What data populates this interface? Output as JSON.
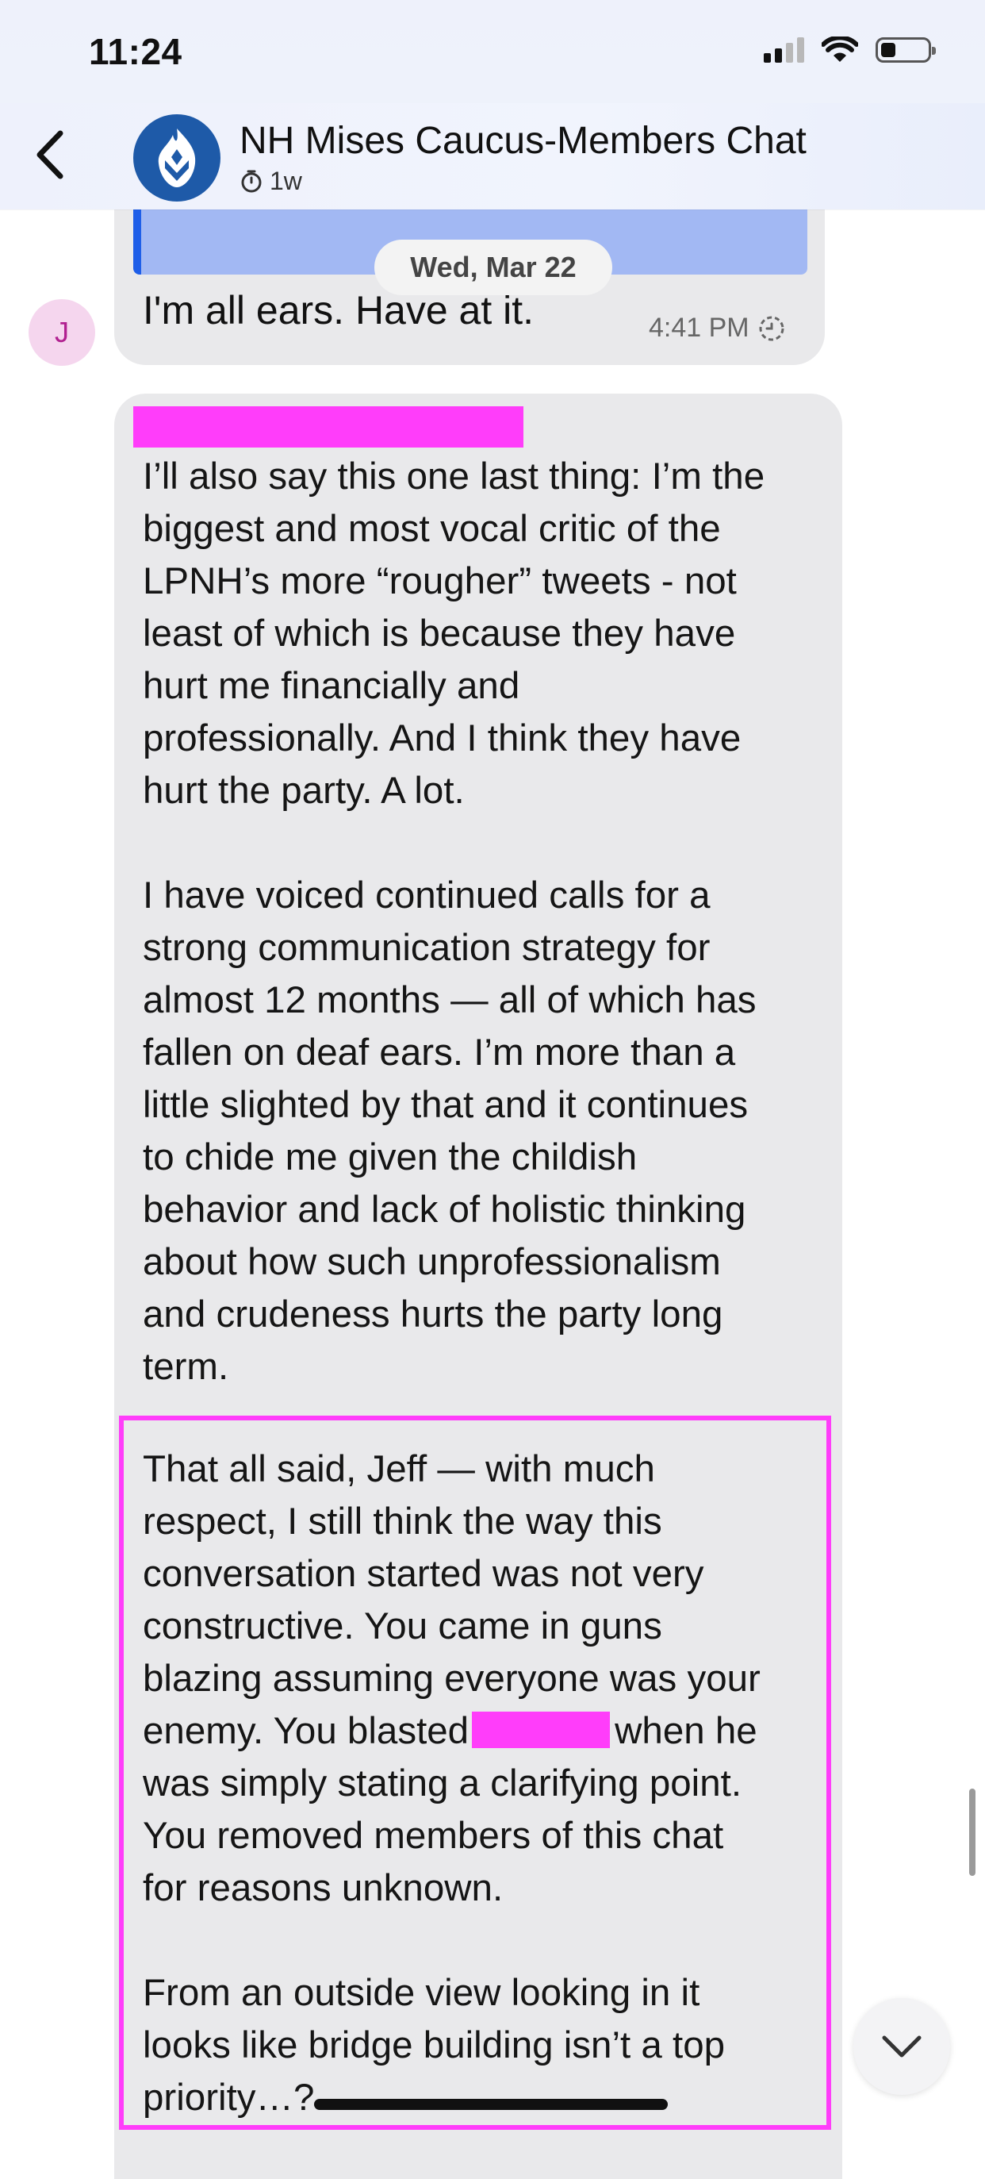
{
  "status_bar": {
    "time": "11:24"
  },
  "header": {
    "title": "NH Mises Caucus-Members Chat",
    "subtitle": "1w"
  },
  "previous_message": {
    "date_separator": "Wed, Mar 22",
    "avatar_initial": "J",
    "text": "I'm all ears. Have at it.",
    "time": "4:41 PM"
  },
  "message": {
    "paragraphs": [
      "I’ll also say this one last thing: I’m the\nbiggest and most vocal critic of the\nLPNH’s more “rougher” tweets - not\nleast of which is because they have\nhurt me financially and\nprofessionally. And I think they have\nhurt the party. A lot.",
      "I have voiced continued calls for a\nstrong communication strategy for\nalmost 12 months — all of which has\nfallen on deaf ears. I’m more than a\nlittle slighted by that and it continues\nto chide me given the  childish\nbehavior and lack of holistic thinking\nabout how such unprofessionalism\nand crudeness hurts the party long\nterm."
    ],
    "highlighted": {
      "before_redaction": "That all said, Jeff — with much\nrespect, I still think the way this\nconversation started was not very\nconstructive. You came in guns\nblazing assuming everyone was your\nenemy. You blasted",
      "after_redaction": "when he\nwas simply stating a clarifying point.\nYou removed members of this chat\nfor reasons unknown.",
      "last_paragraph": "From an outside view looking in it\nlooks like bridge building isn’t a top\npriority…?"
    }
  },
  "colors": {
    "redaction": "#ff3dfa",
    "bubble": "#e9e9eb",
    "quote_bar_accent": "#1e5ee8",
    "avatar_group": "#1e5aa8"
  },
  "icons": {
    "back": "chevron-left-icon",
    "timer": "timer-icon",
    "read_receipt": "sending-status-icon",
    "scroll_down": "chevron-down-icon"
  }
}
